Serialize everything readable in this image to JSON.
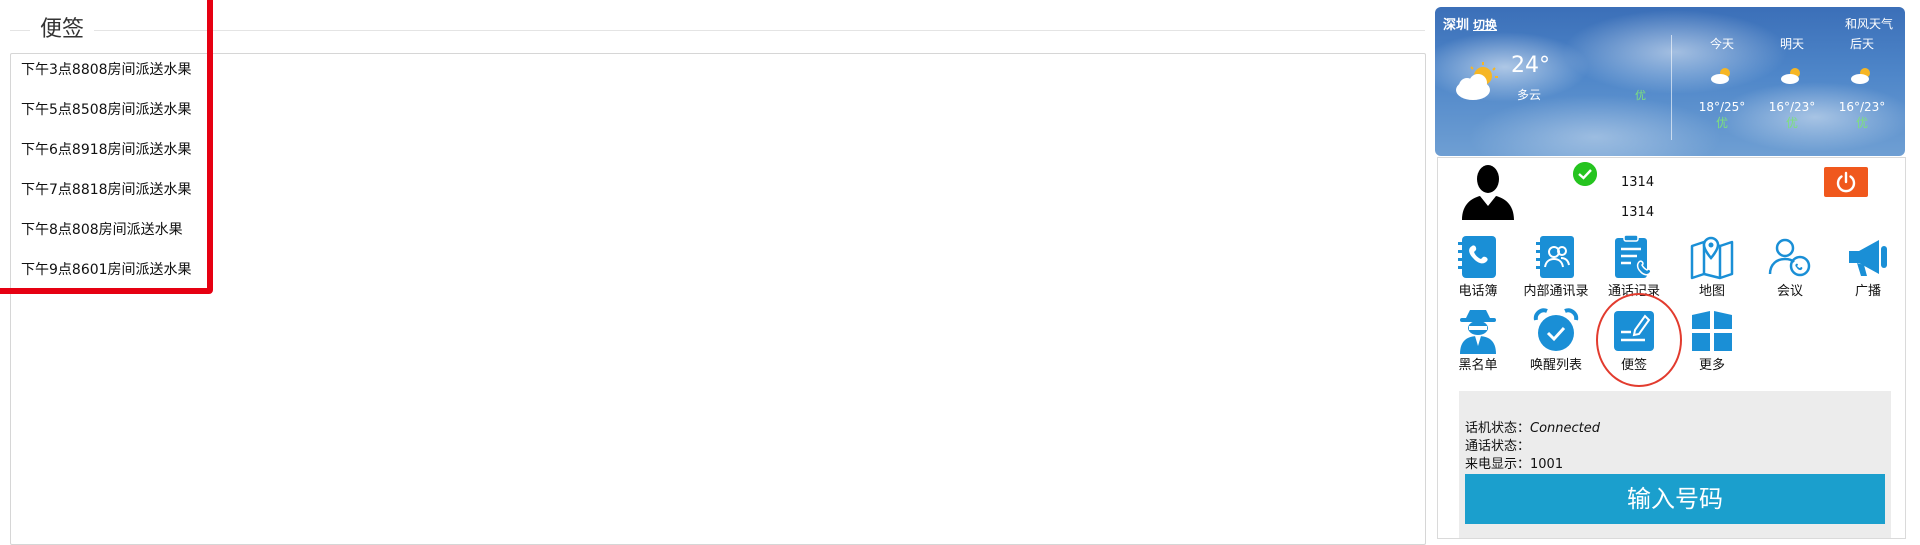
{
  "notes": {
    "title": "便签",
    "items": [
      "下午3点8808房间派送水果",
      "下午5点8508房间派送水果",
      "下午6点8918房间派送水果",
      "下午7点8818房间派送水果",
      "下午8点808房间派送水果",
      "下午9点8601房间派送水果"
    ]
  },
  "weather": {
    "city": "深圳",
    "switch_label": "切换",
    "brand": "和风天气",
    "temp": "24°",
    "desc": "多云",
    "aq_now": "优",
    "days": [
      {
        "label": "今天",
        "range": "18°/25°",
        "aq": "优"
      },
      {
        "label": "明天",
        "range": "16°/23°",
        "aq": "优"
      },
      {
        "label": "后天",
        "range": "16°/23°",
        "aq": "优"
      }
    ]
  },
  "user": {
    "line1": "1314",
    "line2": "1314"
  },
  "tiles": [
    {
      "label": "电话簿",
      "icon": "phonebook-icon"
    },
    {
      "label": "内部通讯录",
      "icon": "contacts-icon"
    },
    {
      "label": "通话记录",
      "icon": "call-log-icon"
    },
    {
      "label": "地图",
      "icon": "map-icon"
    },
    {
      "label": "会议",
      "icon": "meeting-icon"
    },
    {
      "label": "广播",
      "icon": "megaphone-icon"
    },
    {
      "label": "黑名单",
      "icon": "blacklist-icon"
    },
    {
      "label": "唤醒列表",
      "icon": "alarm-icon"
    },
    {
      "label": "便签",
      "icon": "note-icon"
    },
    {
      "label": "更多",
      "icon": "more-icon"
    }
  ],
  "status": {
    "phone_label": "话机状态：",
    "phone_value": "Connected",
    "call_label": "通话状态：",
    "call_value": "",
    "caller_label": "来电显示：",
    "caller_value": "1001",
    "dial_button": "输入号码"
  },
  "colors": {
    "accent": "#1b9fcd",
    "icon_blue": "#1a8fd6",
    "power": "#f0581d",
    "ok": "#25c41f",
    "annotation_red": "#e60012"
  }
}
